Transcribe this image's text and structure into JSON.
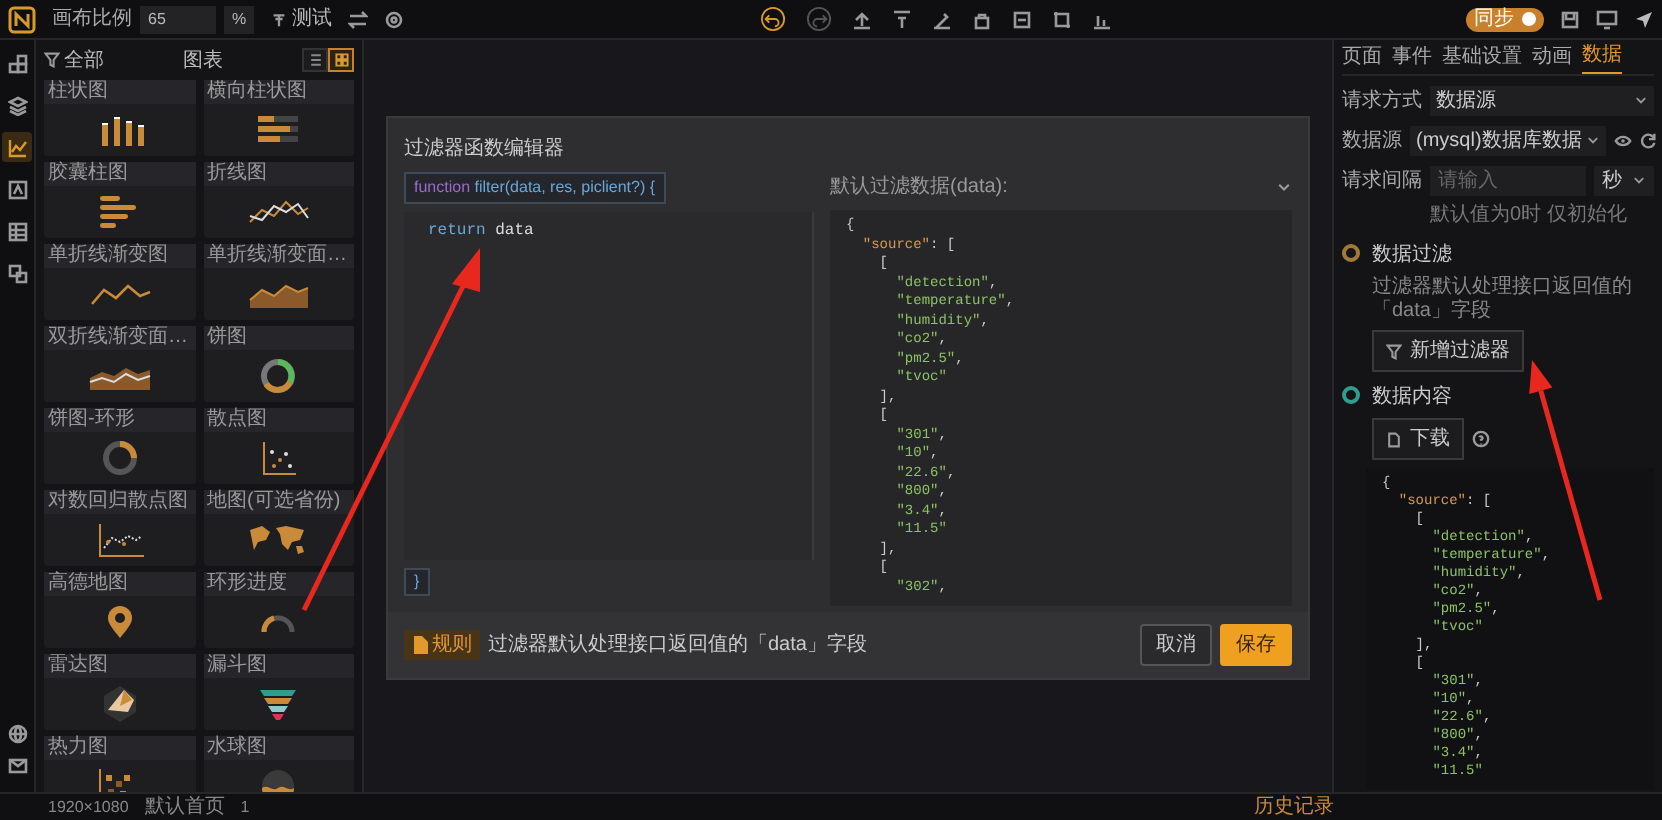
{
  "top_bar": {
    "scale_label": "画布比例",
    "scale_value": "65",
    "scale_unit": "%",
    "test_label": "测试",
    "undo_enabled": true,
    "redo_enabled": false,
    "sync": {
      "label": "同步",
      "on": true
    }
  },
  "rail": {
    "items": [
      {
        "kind": "components",
        "selected": false
      },
      {
        "kind": "layers",
        "selected": false
      },
      {
        "kind": "chart",
        "selected": true
      },
      {
        "kind": "text",
        "selected": false
      },
      {
        "kind": "table",
        "selected": false
      },
      {
        "kind": "media",
        "selected": false
      }
    ]
  },
  "left_panel": {
    "filter_label": "全部",
    "title": "图表",
    "view_modes": [
      {
        "kind": "list",
        "selected": false
      },
      {
        "kind": "grid",
        "selected": true
      }
    ],
    "items": [
      {
        "label": "柱状图",
        "kind": "bar"
      },
      {
        "label": "横向柱状图",
        "kind": "hbar"
      },
      {
        "label": "胶囊柱图",
        "kind": "capsule"
      },
      {
        "label": "折线图",
        "kind": "line"
      },
      {
        "label": "单折线渐变图",
        "kind": "line-gradient"
      },
      {
        "label": "单折线渐变面…",
        "kind": "area"
      },
      {
        "label": "双折线渐变面…",
        "kind": "area2"
      },
      {
        "label": "饼图",
        "kind": "pie"
      },
      {
        "label": "饼图-环形",
        "kind": "ring"
      },
      {
        "label": "散点图",
        "kind": "scatter"
      },
      {
        "label": "对数回归散点图",
        "kind": "scatter2"
      },
      {
        "label": "地图(可选省份)",
        "kind": "map"
      },
      {
        "label": "高德地图",
        "kind": "pin"
      },
      {
        "label": "环形进度",
        "kind": "gauge"
      },
      {
        "label": "雷达图",
        "kind": "radar"
      },
      {
        "label": "漏斗图",
        "kind": "funnel"
      },
      {
        "label": "热力图",
        "kind": "heatmap"
      },
      {
        "label": "水球图",
        "kind": "waterball"
      }
    ]
  },
  "modal": {
    "title": "过滤器函数编辑器",
    "signature": {
      "keyword": "function",
      "text": "filter(data, res, piclient?) {"
    },
    "body": {
      "keyword": "return",
      "text": "data"
    },
    "closing": "}",
    "preview_label": "默认过滤数据(data):",
    "preview_code": "{\n  \"source\": [\n    [\n      \"detection\",\n      \"temperature\",\n      \"humidity\",\n      \"co2\",\n      \"pm2.5\",\n      \"tvoc\"\n    ],\n    [\n      \"301\",\n      \"10\",\n      \"22.6\",\n      \"800\",\n      \"3.4\",\n      \"11.5\"\n    ],\n    [\n      \"302\",",
    "rule_badge": "规则",
    "rule_text": "过滤器默认处理接口返回值的「data」字段",
    "buttons": [
      {
        "label": "取消",
        "kind": "secondary"
      },
      {
        "label": "保存",
        "kind": "primary"
      }
    ]
  },
  "right_panel": {
    "tabs": [
      {
        "label": "页面",
        "selected": false
      },
      {
        "label": "事件",
        "selected": false
      },
      {
        "label": "基础设置",
        "selected": false
      },
      {
        "label": "动画",
        "selected": false
      },
      {
        "label": "数据",
        "selected": true
      }
    ],
    "fields": [
      {
        "kind": "select",
        "label": "请求方式",
        "value": "数据源"
      },
      {
        "kind": "select-actions",
        "label": "数据源",
        "value": "(mysql)数据库数据"
      },
      {
        "kind": "input-unit",
        "label": "请求间隔",
        "placeholder": "请输入",
        "unit": "秒"
      }
    ],
    "hint": "默认值为0时 仅初始化",
    "steps": [
      {
        "title": "数据过滤",
        "color": "#a07a3a",
        "description": "过滤器默认处理接口返回值的「data」字段",
        "button": "新增过滤器"
      },
      {
        "title": "数据内容",
        "color": "#2f9e8f",
        "button": "下载"
      }
    ],
    "code": "{\n  \"source\": [\n    [\n      \"detection\",\n      \"temperature\",\n      \"humidity\",\n      \"co2\",\n      \"pm2.5\",\n      \"tvoc\"\n    ],\n    [\n      \"301\",\n      \"10\",\n      \"22.6\",\n      \"800\",\n      \"3.4\",\n      \"11.5\""
  },
  "status_bar": {
    "resolution": "1920×1080",
    "page": "默认首页",
    "count": "1",
    "history": "历史记录"
  }
}
